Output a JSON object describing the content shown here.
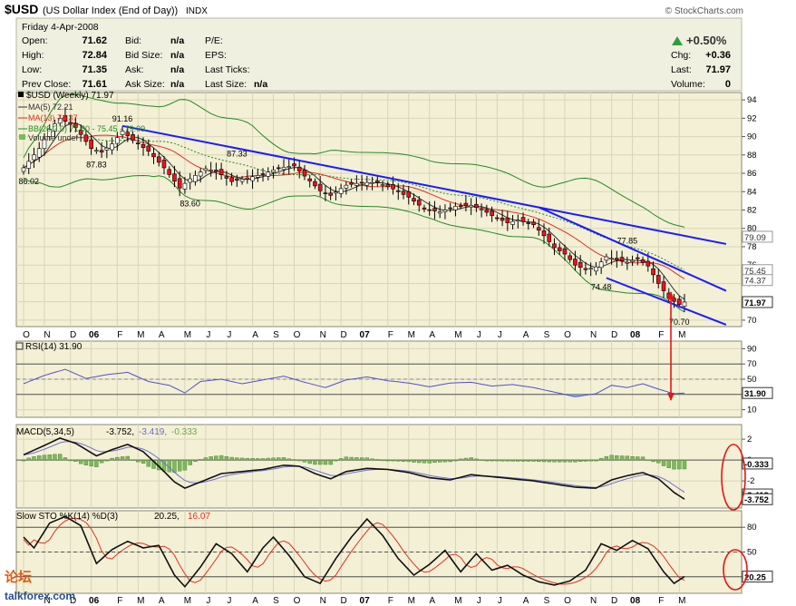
{
  "header": {
    "symbol": "$USD",
    "name": "(US Dollar Index (End of Day))",
    "exchange": "INDX",
    "watermark": "© StockCharts.com",
    "date": "Friday   4-Apr-2008",
    "quote": [
      {
        "label": "Open:",
        "value": "71.62"
      },
      {
        "label": "High:",
        "value": "72.84"
      },
      {
        "label": "Low:",
        "value": "71.35"
      },
      {
        "label": "Prev Close:",
        "value": "71.61"
      }
    ],
    "bidask": [
      {
        "label": "Bid:",
        "value": "n/a"
      },
      {
        "label": "Bid Size:",
        "value": "n/a"
      },
      {
        "label": "Ask:",
        "value": "n/a"
      },
      {
        "label": "Ask Size:",
        "value": "n/a"
      }
    ],
    "misc": [
      {
        "label": "P/E:",
        "value": ""
      },
      {
        "label": "EPS:",
        "value": ""
      },
      {
        "label": "Last Ticks:",
        "value": ""
      },
      {
        "label": "Last Size:",
        "value": "n/a"
      }
    ],
    "change_pct": "+0.50%",
    "summary": [
      {
        "label": "Chg:",
        "value": "+0.36"
      },
      {
        "label": "Last:",
        "value": "71.97"
      },
      {
        "label": "Volume:",
        "value": "0"
      }
    ]
  },
  "legend": {
    "price": "$USD (Weekly) 71.97",
    "ma5": "MA(5) 72.21",
    "ma13": "MA(13) 74.37",
    "bb": "BB(26,2.0) 71.80 - 75.45 - 79.09",
    "volume": "Volume undef",
    "rsi": "RSI(14) 31.90",
    "macd_name": "MACD(5,34,5)",
    "macd_v1": "-3.752,",
    "macd_v2": "-3.419,",
    "macd_v3": "-0.333",
    "sto_name": "Slow STO %K(14) %D(3)",
    "sto_k": "20.25,",
    "sto_d": "16.07"
  },
  "colors": {
    "panel_bg": "#f3f0d6",
    "header_bg": "#f0f0e0",
    "up": "#ffffff",
    "down": "#e8141d",
    "trend": "#1a1aff",
    "annotation": "#e51616",
    "ma5": "#333333",
    "ma13": "#e03020",
    "bb": "#228b22",
    "rsi": "#5050d0",
    "macd": "#111111",
    "signal": "#7070d0",
    "hist": "#7db85a",
    "sto_k": "#111111",
    "sto_d": "#e03020"
  },
  "x_axis": {
    "top": [
      {
        "label": "S",
        "i": -4
      },
      {
        "label": "O",
        "i": 0
      },
      {
        "label": "N",
        "i": 4
      },
      {
        "label": "D",
        "i": 9
      },
      {
        "label": "06",
        "i": 13,
        "bold": true
      },
      {
        "label": "F",
        "i": 18
      },
      {
        "label": "M",
        "i": 22
      },
      {
        "label": "A",
        "i": 26
      },
      {
        "label": "M",
        "i": 31
      },
      {
        "label": "J",
        "i": 35
      },
      {
        "label": "J",
        "i": 39
      },
      {
        "label": "A",
        "i": 44
      },
      {
        "label": "S",
        "i": 48
      },
      {
        "label": "O",
        "i": 52
      },
      {
        "label": "N",
        "i": 57
      },
      {
        "label": "D",
        "i": 61
      },
      {
        "label": "07",
        "i": 65,
        "bold": true
      },
      {
        "label": "F",
        "i": 70
      },
      {
        "label": "M",
        "i": 74
      },
      {
        "label": "A",
        "i": 78
      },
      {
        "label": "M",
        "i": 83
      },
      {
        "label": "J",
        "i": 87
      },
      {
        "label": "J",
        "i": 91
      },
      {
        "label": "A",
        "i": 96
      },
      {
        "label": "S",
        "i": 100
      },
      {
        "label": "O",
        "i": 104
      },
      {
        "label": "N",
        "i": 109
      },
      {
        "label": "D",
        "i": 113
      },
      {
        "label": "08",
        "i": 117,
        "bold": true
      },
      {
        "label": "F",
        "i": 122
      },
      {
        "label": "M",
        "i": 126
      }
    ],
    "bottom": [
      {
        "label": "S",
        "i": -4
      },
      {
        "label": "O",
        "i": 0
      },
      {
        "label": "N",
        "i": 4
      },
      {
        "label": "D",
        "i": 9
      },
      {
        "label": "06",
        "i": 13,
        "bold": true
      },
      {
        "label": "F",
        "i": 18
      },
      {
        "label": "M",
        "i": 22
      },
      {
        "label": "A",
        "i": 26
      },
      {
        "label": "M",
        "i": 31
      },
      {
        "label": "J",
        "i": 35
      },
      {
        "label": "J",
        "i": 39
      },
      {
        "label": "A",
        "i": 44
      },
      {
        "label": "S",
        "i": 48
      },
      {
        "label": "O",
        "i": 52
      },
      {
        "label": "N",
        "i": 57
      },
      {
        "label": "D",
        "i": 61
      },
      {
        "label": "07",
        "i": 65,
        "bold": true
      },
      {
        "label": "F",
        "i": 70
      },
      {
        "label": "M",
        "i": 74
      },
      {
        "label": "A",
        "i": 78
      },
      {
        "label": "M",
        "i": 83
      },
      {
        "label": "J",
        "i": 87
      },
      {
        "label": "J",
        "i": 91
      },
      {
        "label": "A",
        "i": 96
      },
      {
        "label": "S",
        "i": 100
      },
      {
        "label": "O",
        "i": 104
      },
      {
        "label": "N",
        "i": 109
      },
      {
        "label": "D",
        "i": 113
      },
      {
        "label": "08",
        "i": 117,
        "bold": true
      },
      {
        "label": "F",
        "i": 122
      },
      {
        "label": "M",
        "i": 126
      }
    ]
  },
  "chart_data": [
    {
      "type": "candlestick",
      "panel": "price",
      "title": "$USD (Weekly) 71.97",
      "ylim": [
        69.3,
        94.8
      ],
      "yticks": [
        70,
        72,
        74,
        76,
        78,
        80,
        82,
        84,
        86,
        88,
        90,
        92,
        94
      ],
      "anchors": [
        {
          "i": 0,
          "v": 86.6
        },
        {
          "i": 3,
          "v": 88.7
        },
        {
          "i": 5,
          "v": 90.8
        },
        {
          "i": 7,
          "v": 92.0
        },
        {
          "i": 10,
          "v": 91.0
        },
        {
          "i": 13,
          "v": 88.7
        },
        {
          "i": 15,
          "v": 88.3
        },
        {
          "i": 17,
          "v": 89.2
        },
        {
          "i": 19,
          "v": 90.6
        },
        {
          "i": 21,
          "v": 89.6
        },
        {
          "i": 24,
          "v": 88.4
        },
        {
          "i": 27,
          "v": 86.6
        },
        {
          "i": 30,
          "v": 84.4
        },
        {
          "i": 32,
          "v": 85.4
        },
        {
          "i": 35,
          "v": 86.5
        },
        {
          "i": 37,
          "v": 86.2
        },
        {
          "i": 40,
          "v": 85.1
        },
        {
          "i": 43,
          "v": 85.5
        },
        {
          "i": 46,
          "v": 85.9
        },
        {
          "i": 49,
          "v": 86.6
        },
        {
          "i": 52,
          "v": 86.8
        },
        {
          "i": 54,
          "v": 85.7
        },
        {
          "i": 57,
          "v": 84.1
        },
        {
          "i": 59,
          "v": 83.6
        },
        {
          "i": 62,
          "v": 84.7
        },
        {
          "i": 65,
          "v": 85.0
        },
        {
          "i": 68,
          "v": 85.0
        },
        {
          "i": 71,
          "v": 84.3
        },
        {
          "i": 74,
          "v": 83.4
        },
        {
          "i": 77,
          "v": 82.1
        },
        {
          "i": 80,
          "v": 81.8
        },
        {
          "i": 83,
          "v": 82.4
        },
        {
          "i": 86,
          "v": 82.5
        },
        {
          "i": 88,
          "v": 82.1
        },
        {
          "i": 90,
          "v": 81.4
        },
        {
          "i": 93,
          "v": 80.6
        },
        {
          "i": 95,
          "v": 80.9
        },
        {
          "i": 98,
          "v": 80.4
        },
        {
          "i": 100,
          "v": 79.2
        },
        {
          "i": 102,
          "v": 77.9
        },
        {
          "i": 104,
          "v": 77.2
        },
        {
          "i": 106,
          "v": 76.0
        },
        {
          "i": 108,
          "v": 75.5
        },
        {
          "i": 110,
          "v": 75.8
        },
        {
          "i": 112,
          "v": 76.9
        },
        {
          "i": 114,
          "v": 76.6
        },
        {
          "i": 116,
          "v": 76.3
        },
        {
          "i": 118,
          "v": 76.7
        },
        {
          "i": 120,
          "v": 75.9
        },
        {
          "i": 122,
          "v": 74.0
        },
        {
          "i": 124,
          "v": 72.4
        },
        {
          "i": 126,
          "v": 71.7
        },
        {
          "i": 127,
          "v": 71.97
        }
      ],
      "labels": [
        {
          "i": 1,
          "v": 86.02,
          "text": "86.02",
          "pos": "below"
        },
        {
          "i": 14,
          "v": 87.83,
          "text": "87.83",
          "pos": "below"
        },
        {
          "i": 19,
          "v": 91.16,
          "text": "91.16",
          "pos": "above"
        },
        {
          "i": 32,
          "v": 83.6,
          "text": "83.60",
          "pos": "below"
        },
        {
          "i": 41,
          "v": 87.33,
          "text": "87.33",
          "pos": "above"
        },
        {
          "i": 111,
          "v": 74.48,
          "text": "74.48",
          "pos": "below"
        },
        {
          "i": 116,
          "v": 77.85,
          "text": "77.85",
          "pos": "above"
        },
        {
          "i": 126,
          "v": 70.7,
          "text": "70.70",
          "pos": "below"
        }
      ],
      "right_labels": [
        {
          "v": 79.09,
          "text": "79.09",
          "box": false
        },
        {
          "v": 75.45,
          "text": "75.45",
          "box": false
        },
        {
          "v": 74.37,
          "text": "74.37",
          "box": false
        },
        {
          "v": 71.97,
          "text": "71.97",
          "box": true
        }
      ],
      "trendlines": [
        {
          "from": [
            19,
            91.16
          ],
          "to": [
            135,
            78.3
          ]
        },
        {
          "from": [
            99,
            82.3
          ],
          "to": [
            135,
            73.2
          ]
        },
        {
          "from": [
            112,
            74.6
          ],
          "to": [
            135,
            69.5
          ]
        }
      ]
    },
    {
      "type": "line",
      "panel": "rsi",
      "title": "RSI(14) 31.90",
      "ylim": [
        0,
        100
      ],
      "yticks": [
        10,
        30,
        50,
        70,
        90
      ],
      "levels": [
        70,
        30
      ],
      "anchors": [
        {
          "i": 0,
          "v": 44
        },
        {
          "i": 4,
          "v": 55
        },
        {
          "i": 8,
          "v": 63
        },
        {
          "i": 12,
          "v": 51
        },
        {
          "i": 16,
          "v": 56
        },
        {
          "i": 20,
          "v": 59
        },
        {
          "i": 24,
          "v": 47
        },
        {
          "i": 28,
          "v": 42
        },
        {
          "i": 31,
          "v": 32
        },
        {
          "i": 34,
          "v": 47
        },
        {
          "i": 38,
          "v": 50
        },
        {
          "i": 42,
          "v": 44
        },
        {
          "i": 46,
          "v": 49
        },
        {
          "i": 50,
          "v": 54
        },
        {
          "i": 54,
          "v": 46
        },
        {
          "i": 58,
          "v": 39
        },
        {
          "i": 62,
          "v": 49
        },
        {
          "i": 66,
          "v": 53
        },
        {
          "i": 70,
          "v": 48
        },
        {
          "i": 74,
          "v": 45
        },
        {
          "i": 78,
          "v": 40
        },
        {
          "i": 82,
          "v": 45
        },
        {
          "i": 86,
          "v": 46
        },
        {
          "i": 90,
          "v": 41
        },
        {
          "i": 94,
          "v": 43
        },
        {
          "i": 98,
          "v": 39
        },
        {
          "i": 102,
          "v": 33
        },
        {
          "i": 106,
          "v": 27
        },
        {
          "i": 110,
          "v": 31
        },
        {
          "i": 113,
          "v": 42
        },
        {
          "i": 116,
          "v": 39
        },
        {
          "i": 119,
          "v": 44
        },
        {
          "i": 122,
          "v": 37
        },
        {
          "i": 125,
          "v": 31
        },
        {
          "i": 127,
          "v": 31.9
        }
      ],
      "right_labels": [
        {
          "v": 31.9,
          "text": "31.90",
          "box": true
        }
      ],
      "trendlines": [
        {
          "from": [
            108,
            23.5
          ],
          "to": [
            138,
            30.5
          ]
        }
      ]
    },
    {
      "type": "line",
      "panel": "macd",
      "title": "MACD(5,34,5) -3.752, -3.419, -0.333",
      "ylim": [
        -4.6,
        3.4
      ],
      "yticks": [
        2,
        0,
        -2
      ],
      "levels": [
        0
      ],
      "anchors": [
        {
          "i": 0,
          "v": 0.5
        },
        {
          "i": 4,
          "v": 1.4
        },
        {
          "i": 7,
          "v": 2.1
        },
        {
          "i": 10,
          "v": 1.6
        },
        {
          "i": 14,
          "v": 0.4
        },
        {
          "i": 17,
          "v": 1.0
        },
        {
          "i": 20,
          "v": 1.5
        },
        {
          "i": 23,
          "v": 0.8
        },
        {
          "i": 26,
          "v": -0.6
        },
        {
          "i": 29,
          "v": -2.1
        },
        {
          "i": 31,
          "v": -2.7
        },
        {
          "i": 34,
          "v": -2.1
        },
        {
          "i": 38,
          "v": -1.3
        },
        {
          "i": 42,
          "v": -1.1
        },
        {
          "i": 46,
          "v": -0.9
        },
        {
          "i": 50,
          "v": -0.5
        },
        {
          "i": 53,
          "v": -0.6
        },
        {
          "i": 56,
          "v": -1.3
        },
        {
          "i": 59,
          "v": -1.8
        },
        {
          "i": 62,
          "v": -1.1
        },
        {
          "i": 66,
          "v": -0.8
        },
        {
          "i": 70,
          "v": -0.9
        },
        {
          "i": 74,
          "v": -1.2
        },
        {
          "i": 78,
          "v": -1.7
        },
        {
          "i": 82,
          "v": -1.9
        },
        {
          "i": 86,
          "v": -1.4
        },
        {
          "i": 90,
          "v": -1.6
        },
        {
          "i": 94,
          "v": -1.8
        },
        {
          "i": 98,
          "v": -2.0
        },
        {
          "i": 102,
          "v": -2.3
        },
        {
          "i": 106,
          "v": -2.6
        },
        {
          "i": 110,
          "v": -2.7
        },
        {
          "i": 113,
          "v": -1.9
        },
        {
          "i": 116,
          "v": -1.5
        },
        {
          "i": 119,
          "v": -1.2
        },
        {
          "i": 122,
          "v": -1.8
        },
        {
          "i": 125,
          "v": -3.1
        },
        {
          "i": 127,
          "v": -3.752
        }
      ],
      "right_labels": [
        {
          "v": -0.333,
          "text": "-0.333",
          "box": true
        },
        {
          "v": -3.3,
          "text": "-3.419",
          "box": true
        },
        {
          "v": -3.752,
          "text": "-3.752",
          "box": true
        }
      ]
    },
    {
      "type": "line",
      "panel": "sto",
      "title": "Slow STO %K(14) %D(3) 20.25, 16.07",
      "ylim": [
        0,
        100
      ],
      "yticks": [
        80,
        50,
        20
      ],
      "levels": [
        80,
        50,
        20
      ],
      "anchors": [
        {
          "i": 0,
          "v": 68
        },
        {
          "i": 2,
          "v": 55
        },
        {
          "i": 5,
          "v": 85
        },
        {
          "i": 8,
          "v": 93
        },
        {
          "i": 11,
          "v": 82
        },
        {
          "i": 14,
          "v": 36
        },
        {
          "i": 17,
          "v": 53
        },
        {
          "i": 20,
          "v": 63
        },
        {
          "i": 23,
          "v": 55
        },
        {
          "i": 26,
          "v": 58
        },
        {
          "i": 29,
          "v": 22
        },
        {
          "i": 31,
          "v": 8
        },
        {
          "i": 34,
          "v": 32
        },
        {
          "i": 37,
          "v": 60
        },
        {
          "i": 40,
          "v": 48
        },
        {
          "i": 43,
          "v": 26
        },
        {
          "i": 46,
          "v": 55
        },
        {
          "i": 48,
          "v": 68
        },
        {
          "i": 51,
          "v": 46
        },
        {
          "i": 54,
          "v": 20
        },
        {
          "i": 57,
          "v": 12
        },
        {
          "i": 60,
          "v": 42
        },
        {
          "i": 63,
          "v": 68
        },
        {
          "i": 66,
          "v": 90
        },
        {
          "i": 69,
          "v": 70
        },
        {
          "i": 72,
          "v": 42
        },
        {
          "i": 75,
          "v": 22
        },
        {
          "i": 78,
          "v": 35
        },
        {
          "i": 81,
          "v": 52
        },
        {
          "i": 84,
          "v": 26
        },
        {
          "i": 87,
          "v": 48
        },
        {
          "i": 90,
          "v": 28
        },
        {
          "i": 93,
          "v": 34
        },
        {
          "i": 96,
          "v": 22
        },
        {
          "i": 99,
          "v": 14
        },
        {
          "i": 102,
          "v": 10
        },
        {
          "i": 105,
          "v": 15
        },
        {
          "i": 108,
          "v": 28
        },
        {
          "i": 111,
          "v": 60
        },
        {
          "i": 114,
          "v": 52
        },
        {
          "i": 117,
          "v": 64
        },
        {
          "i": 120,
          "v": 54
        },
        {
          "i": 123,
          "v": 26
        },
        {
          "i": 125,
          "v": 12
        },
        {
          "i": 127,
          "v": 20.25
        }
      ],
      "right_labels": [
        {
          "v": 20.25,
          "text": "20.25",
          "box": true
        }
      ]
    }
  ],
  "footer": {
    "brand_cn": "论坛",
    "brand_url": "talkforex.com"
  }
}
